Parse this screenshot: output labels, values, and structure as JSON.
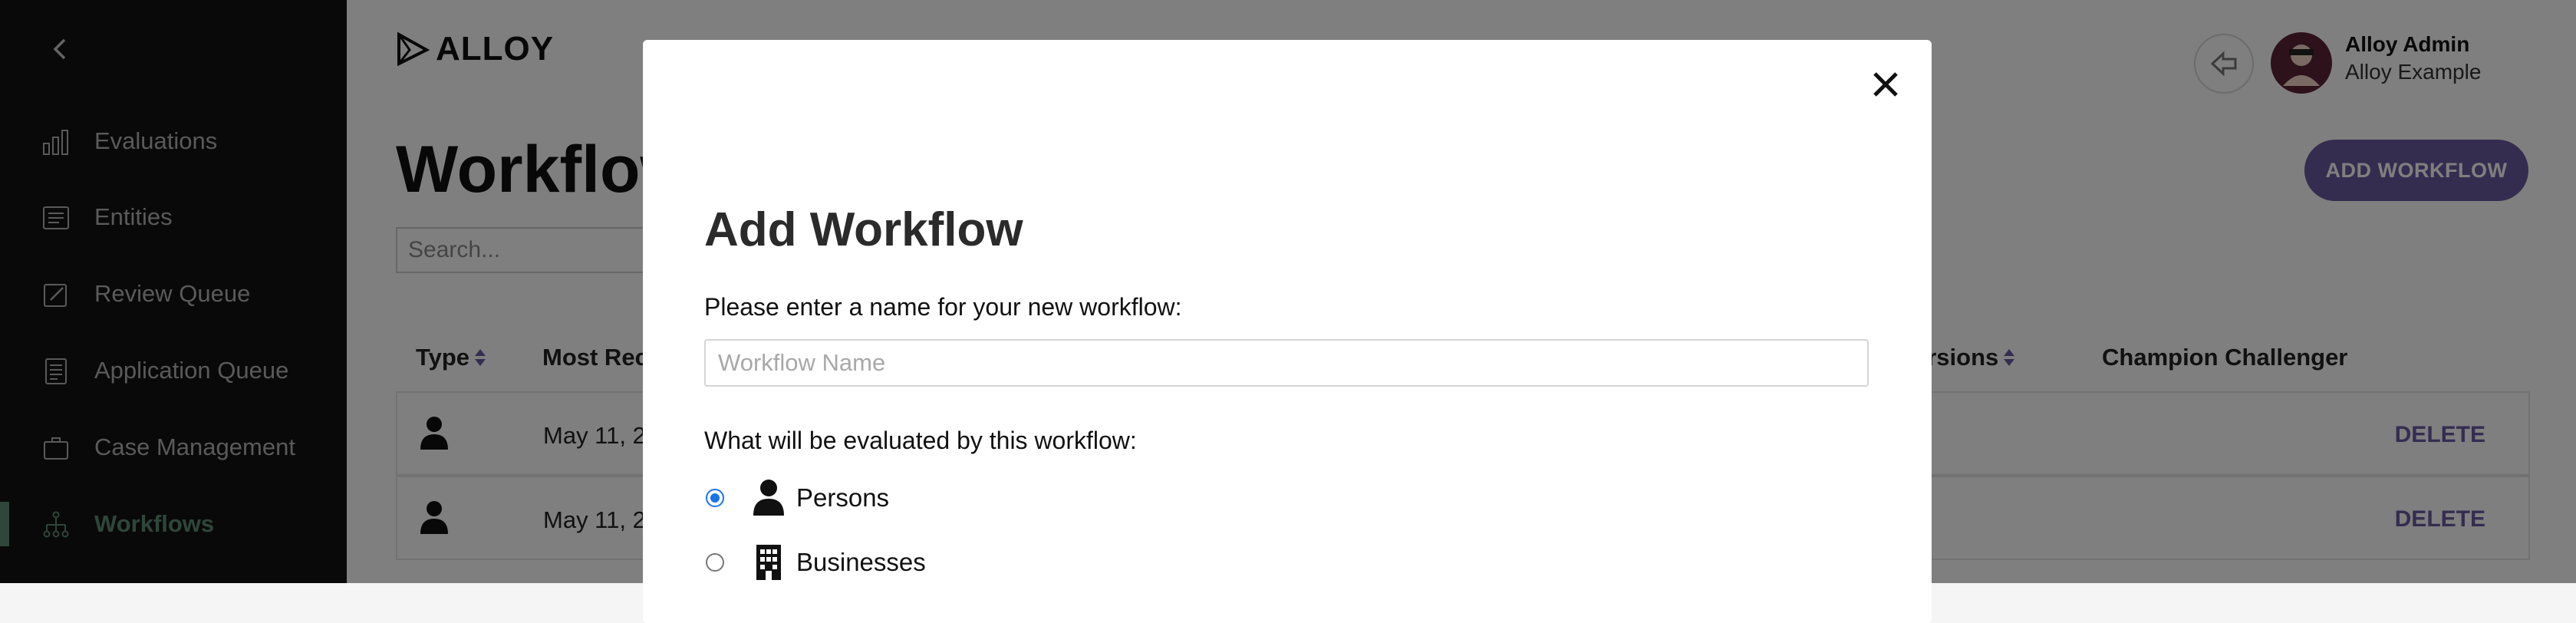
{
  "sidebar": {
    "items": [
      {
        "label": "Evaluations",
        "icon": "bar-chart-icon",
        "active": false
      },
      {
        "label": "Entities",
        "icon": "list-icon",
        "active": false
      },
      {
        "label": "Review Queue",
        "icon": "edit-icon",
        "active": false
      },
      {
        "label": "Application Queue",
        "icon": "document-icon",
        "active": false
      },
      {
        "label": "Case Management",
        "icon": "briefcase-icon",
        "active": false
      },
      {
        "label": "Workflows",
        "icon": "hierarchy-icon",
        "active": true
      }
    ],
    "accent_color": "#5e8d74"
  },
  "header": {
    "logo_text": "ALLOY",
    "user_name": "Alloy Admin",
    "user_org": "Alloy Example"
  },
  "page": {
    "title": "Workflows",
    "add_button_label": "ADD WORKFLOW",
    "search_placeholder": "Search...",
    "accent_color": "#6b5aa0"
  },
  "table": {
    "headers": {
      "type": "Type",
      "most_recent": "Most Rec",
      "versions": "ersions",
      "champion_challenger": "Champion Challenger"
    },
    "rows": [
      {
        "type_icon": "person-icon",
        "date": "May 11, 20",
        "action": "DELETE"
      },
      {
        "type_icon": "person-icon",
        "date": "May 11, 20",
        "action": "DELETE"
      }
    ]
  },
  "modal": {
    "title": "Add Workflow",
    "name_prompt": "Please enter a name for your new workflow:",
    "name_placeholder": "Workflow Name",
    "name_value": "",
    "eval_prompt": "What will be evaluated by this workflow:",
    "options": [
      {
        "label": "Persons",
        "icon": "person-icon",
        "selected": true
      },
      {
        "label": "Businesses",
        "icon": "building-icon",
        "selected": false
      }
    ]
  }
}
